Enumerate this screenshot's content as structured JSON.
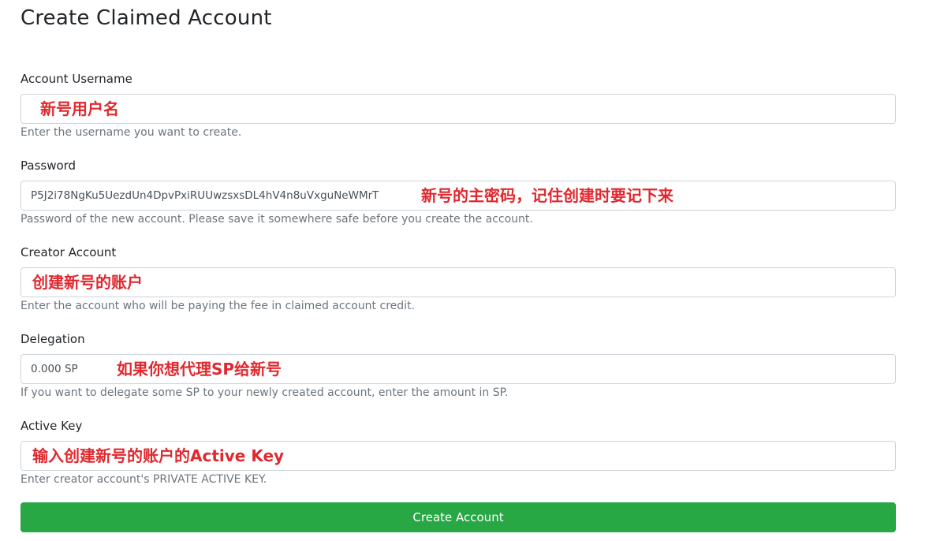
{
  "page": {
    "title": "Create Claimed Account"
  },
  "form": {
    "username": {
      "label": "Account Username",
      "value": "",
      "annotation": "新号用户名",
      "help": "Enter the username you want to create."
    },
    "password": {
      "label": "Password",
      "value": "P5J2i78NgKu5UezdUn4DpvPxiRUUwzsxsDL4hV4n8uVxguNeWMrT",
      "annotation": "新号的主密码，记住创建时要记下来",
      "help": "Password of the new account. Please save it somewhere safe before you create the account."
    },
    "creator": {
      "label": "Creator Account",
      "value": "",
      "annotation": "创建新号的账户",
      "help": "Enter the account who will be paying the fee in claimed account credit."
    },
    "delegation": {
      "label": "Delegation",
      "value": "0.000 SP",
      "annotation": "如果你想代理SP给新号",
      "help": "If you want to delegate some SP to your newly created account, enter the amount in SP."
    },
    "active_key": {
      "label": "Active Key",
      "value": "",
      "annotation": "输入创建新号的账户的Active Key",
      "help": "Enter creator account's PRIVATE ACTIVE KEY."
    },
    "submit_label": "Create Account"
  },
  "colors": {
    "annotation": "#e0282e",
    "button": "#28a745",
    "help_text": "#6c757d",
    "input_border": "#ced4da"
  }
}
